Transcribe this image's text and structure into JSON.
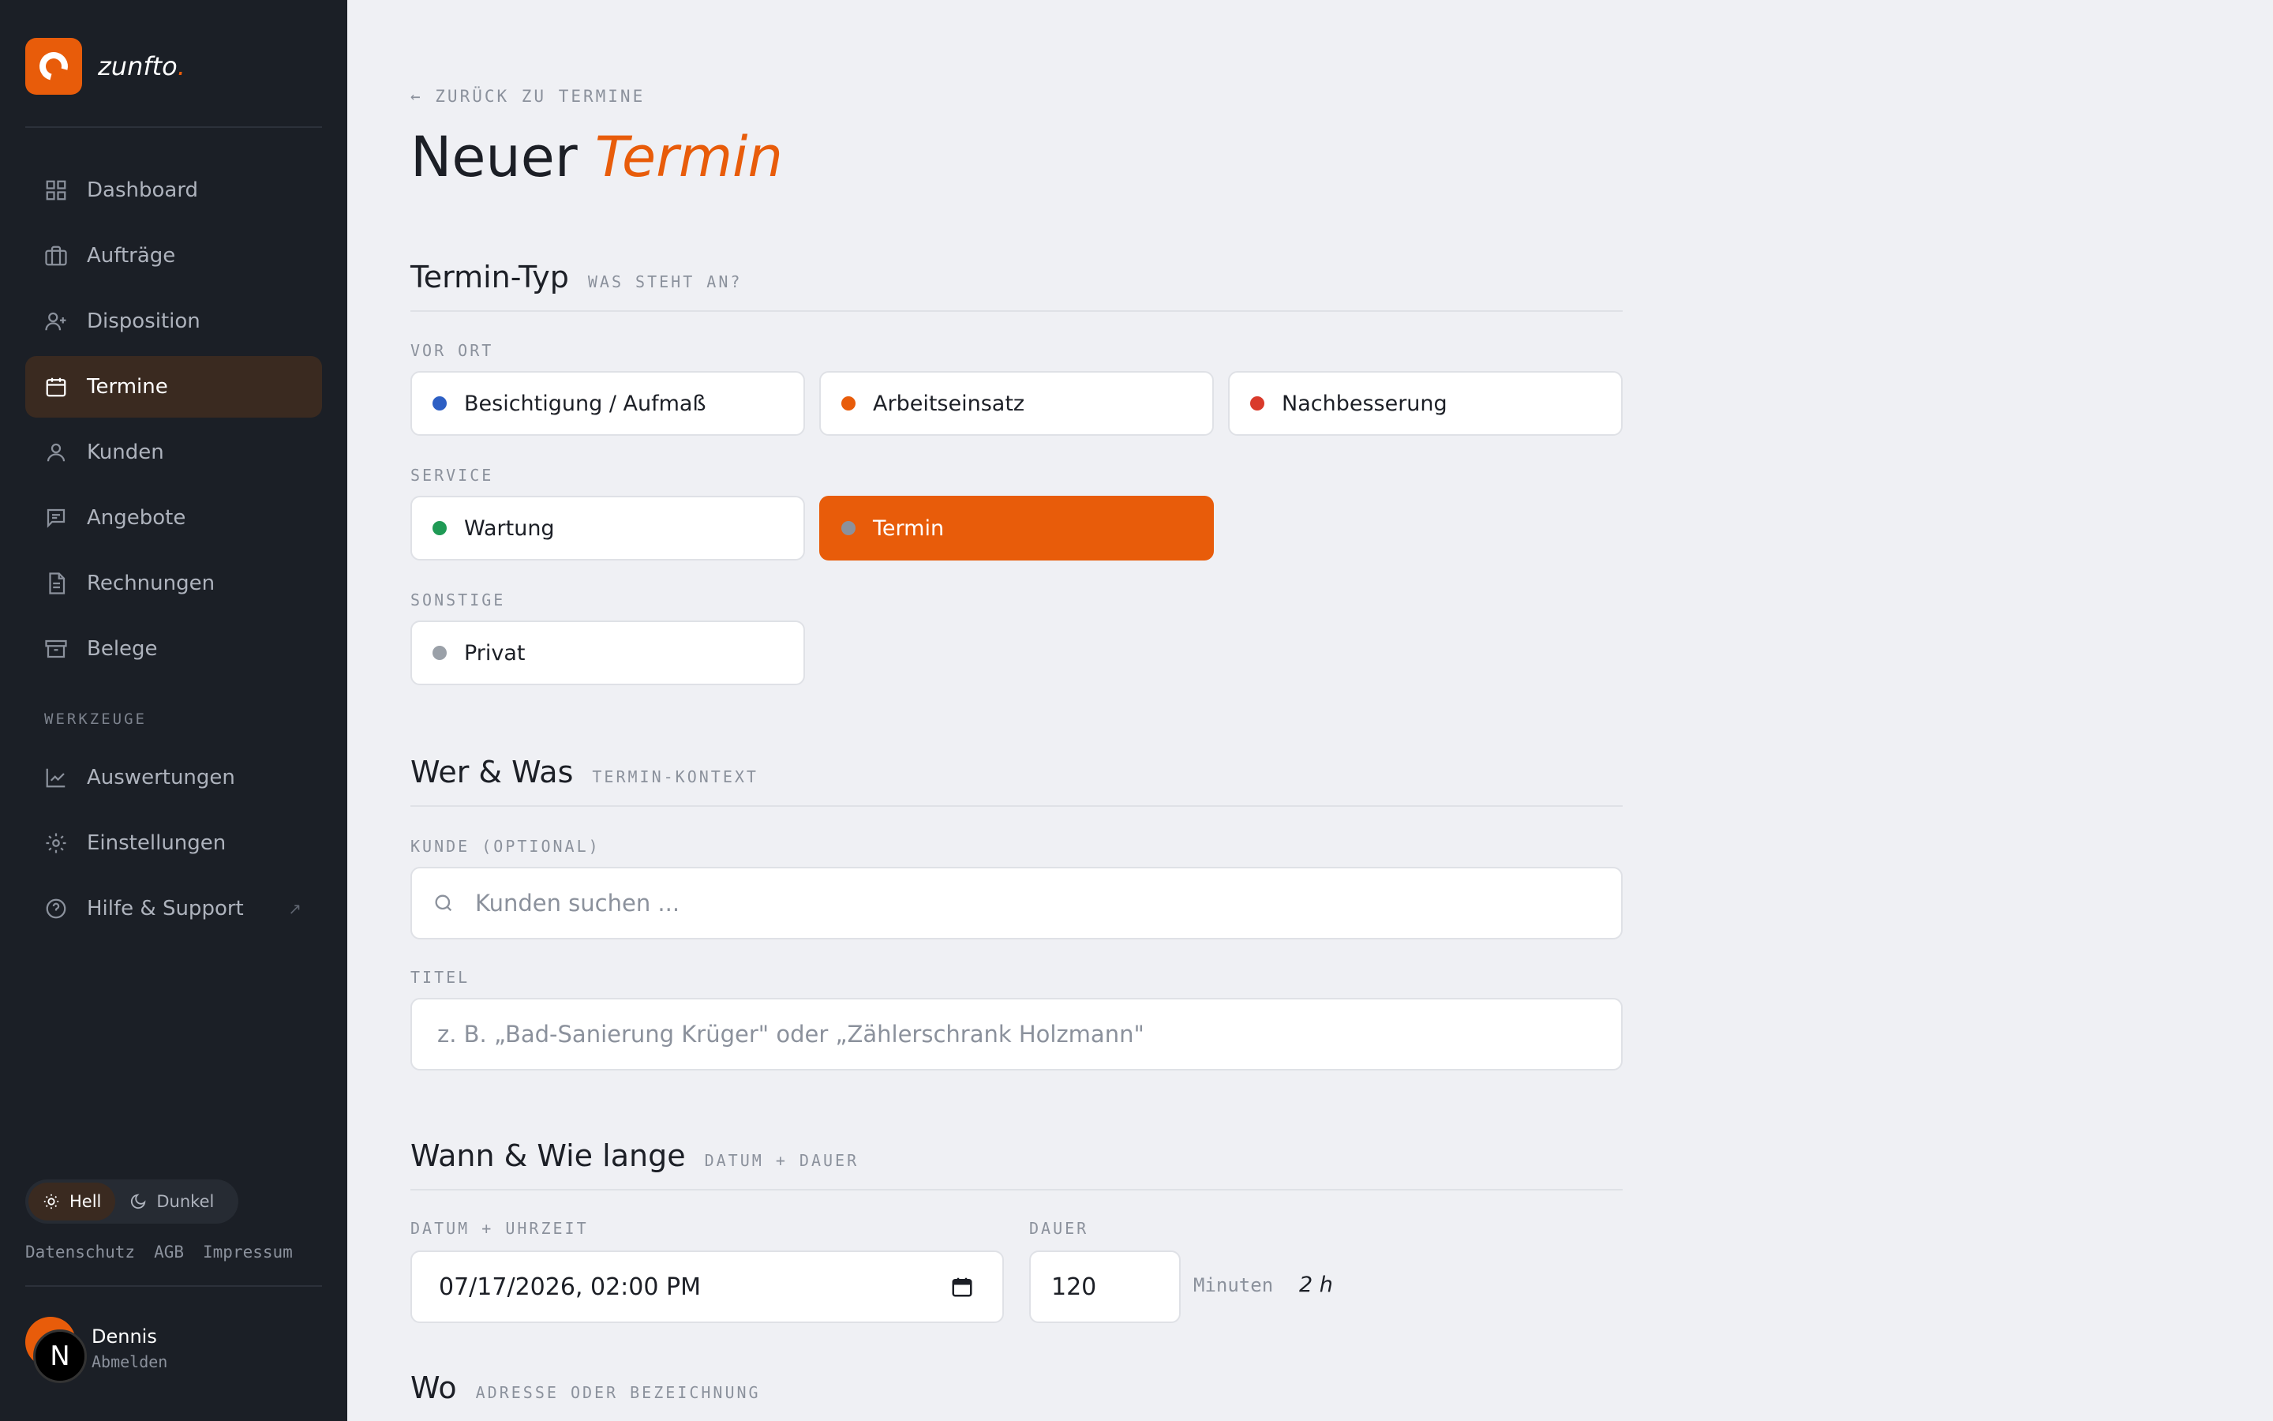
{
  "brand": {
    "name": "zunfto",
    "dot": "."
  },
  "sidebar": {
    "items": [
      {
        "label": "Dashboard",
        "icon": "grid-icon"
      },
      {
        "label": "Aufträge",
        "icon": "briefcase-icon"
      },
      {
        "label": "Disposition",
        "icon": "user-plus-icon"
      },
      {
        "label": "Termine",
        "icon": "calendar-icon",
        "active": true
      },
      {
        "label": "Kunden",
        "icon": "user-icon"
      },
      {
        "label": "Angebote",
        "icon": "message-icon"
      },
      {
        "label": "Rechnungen",
        "icon": "document-icon"
      },
      {
        "label": "Belege",
        "icon": "archive-icon"
      }
    ],
    "tools_label": "WERKZEUGE",
    "tools": [
      {
        "label": "Auswertungen",
        "icon": "chart-icon"
      },
      {
        "label": "Einstellungen",
        "icon": "gear-icon"
      },
      {
        "label": "Hilfe & Support",
        "icon": "help-icon",
        "external": "↗"
      }
    ],
    "theme": {
      "light": "Hell",
      "dark": "Dunkel"
    },
    "legal": [
      "Datenschutz",
      "AGB",
      "Impressum"
    ],
    "user": {
      "name": "Dennis",
      "logout": "Abmelden",
      "initial": "N"
    }
  },
  "main": {
    "back": "← ZURÜCK ZU TERMINE",
    "title_plain": "Neuer",
    "title_accent": "Termin",
    "sections": {
      "type": {
        "title": "Termin-Typ",
        "sub": "WAS STEHT AN?"
      },
      "who": {
        "title": "Wer & Was",
        "sub": "TERMIN-KONTEXT"
      },
      "when": {
        "title": "Wann & Wie lange",
        "sub": "DATUM + DAUER"
      },
      "where": {
        "title": "Wo",
        "sub": "ADRESSE ODER BEZEICHNUNG"
      }
    },
    "type_groups": [
      {
        "label": "VOR ORT",
        "options": [
          {
            "label": "Besichtigung / Aufmaß",
            "color": "#2d5fc4"
          },
          {
            "label": "Arbeitseinsatz",
            "color": "#e85c0a"
          },
          {
            "label": "Nachbesserung",
            "color": "#d93a2b"
          }
        ]
      },
      {
        "label": "SERVICE",
        "options": [
          {
            "label": "Wartung",
            "color": "#1f9a55"
          },
          {
            "label": "Termin",
            "color": "#8b919c",
            "selected": true
          }
        ]
      },
      {
        "label": "SONSTIGE",
        "options": [
          {
            "label": "Privat",
            "color": "#9aa0a8"
          }
        ]
      }
    ],
    "customer": {
      "label": "KUNDE (OPTIONAL)",
      "placeholder": "Kunden suchen ..."
    },
    "titel": {
      "label": "TITEL",
      "placeholder": "z. B. „Bad-Sanierung Krüger\" oder „Zählerschrank Holzmann\""
    },
    "datetime": {
      "label": "DATUM + UHRZEIT",
      "value": "07/17/2026, 02:00 PM"
    },
    "duration": {
      "label": "DAUER",
      "value": "120",
      "unit": "Minuten",
      "hint": "2 h"
    }
  },
  "colors": {
    "accent": "#e85c0a",
    "sidebar_bg": "#1b1f26",
    "page_bg": "#eff0f4"
  }
}
